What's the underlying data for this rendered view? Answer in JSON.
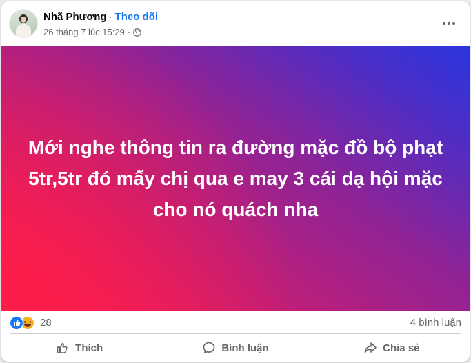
{
  "post": {
    "author": "Nhã Phương",
    "separator": "·",
    "follow_label": "Theo dõi",
    "timestamp": "26 tháng 7 lúc 15:29",
    "meta_separator": "·",
    "privacy_icon": "globe-icon",
    "more_icon": "more-options-icon"
  },
  "banner": {
    "text": "Mới nghe thông tin ra đường mặc đồ bộ phạt 5tr,5tr đó mấy chị qua e may 3 cái dạ hội mặc cho nó quách nha",
    "colors": {
      "start": "#ff1f4e",
      "mid": "#8f2396",
      "end": "#2a36de"
    }
  },
  "reactions": {
    "icons": [
      "like-icon",
      "haha-icon"
    ],
    "count": "28",
    "comments": "4 bình luận"
  },
  "actions": [
    {
      "label": "Thích",
      "icon": "thumbs-up-icon"
    },
    {
      "label": "Bình luận",
      "icon": "comment-icon"
    },
    {
      "label": "Chia sẻ",
      "icon": "share-icon"
    }
  ],
  "colors": {
    "link": "#1877f2",
    "secondary_text": "#65676b",
    "primary_text": "#050505"
  }
}
